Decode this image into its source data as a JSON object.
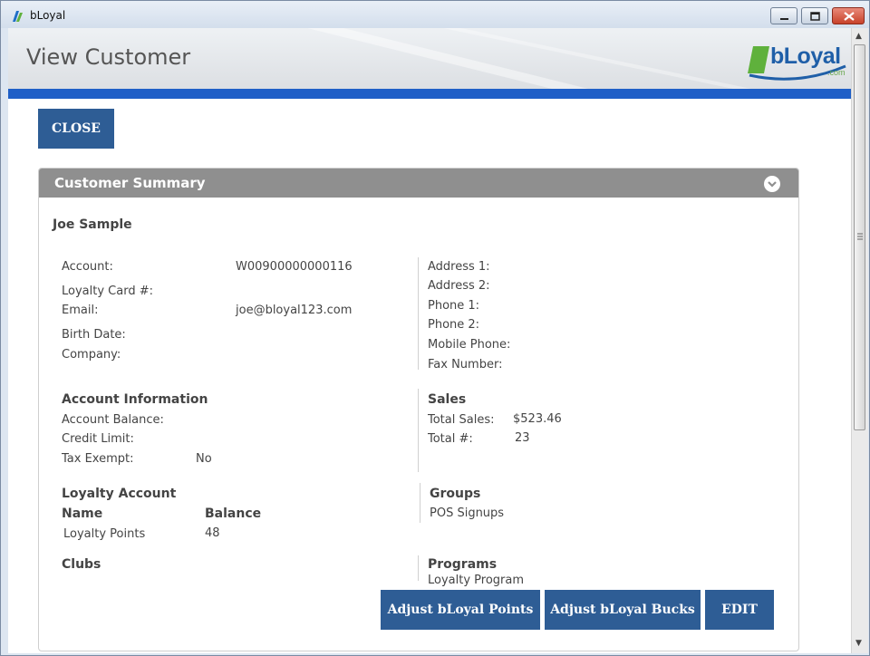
{
  "window": {
    "title": "bLoyal"
  },
  "header": {
    "title": "View Customer",
    "logo_text": "bLoyal",
    "logo_suffix": ".com"
  },
  "toolbar": {
    "close_label": "CLOSE"
  },
  "panel": {
    "title": "Customer Summary"
  },
  "customer": {
    "name": "Joe Sample",
    "left_fields": [
      {
        "label": "Account:",
        "value": "W00900000000116"
      },
      {
        "label": "Loyalty Card #:",
        "value": ""
      },
      {
        "label": "Email:",
        "value": "joe@bloyal123.com"
      },
      {
        "label": "Birth Date:",
        "value": ""
      },
      {
        "label": "Company:",
        "value": ""
      }
    ],
    "right_fields": [
      {
        "label": "Address 1:"
      },
      {
        "label": "Address 2:"
      },
      {
        "label": "Phone 1:"
      },
      {
        "label": "Phone 2:"
      },
      {
        "label": "Mobile Phone:"
      },
      {
        "label": "Fax Number:"
      }
    ]
  },
  "account_info": {
    "heading": "Account Information",
    "balance_label": "Account Balance:",
    "credit_label": "Credit Limit:",
    "tax_label": "Tax Exempt:",
    "tax_value": "No"
  },
  "sales": {
    "heading": "Sales",
    "total_sales_label": "Total Sales:",
    "total_sales_value": "$523.46",
    "total_count_label": "Total #:",
    "total_count_value": "23"
  },
  "loyalty": {
    "heading": "Loyalty Account",
    "col_name": "Name",
    "col_balance": "Balance",
    "row_name": "Loyalty Points",
    "row_balance": "48"
  },
  "groups": {
    "heading": "Groups",
    "value": "POS Signups"
  },
  "clubs": {
    "heading": "Clubs"
  },
  "programs": {
    "heading": "Programs",
    "value": "Loyalty Program"
  },
  "actions": {
    "adjust_points": "Adjust bLoyal Points",
    "adjust_bucks": "Adjust bLoyal Bucks",
    "edit": "EDIT"
  },
  "colors": {
    "accent_blue": "#1f5fc7",
    "button_blue": "#2e5d95",
    "panel_header": "#8f8f8f",
    "brand_green": "#6aa84f"
  },
  "icons": {
    "app": "bloyal-app-icon",
    "collapse": "chevron-down-icon",
    "minimize": "minimize-icon",
    "maximize": "maximize-icon",
    "close": "close-icon"
  }
}
